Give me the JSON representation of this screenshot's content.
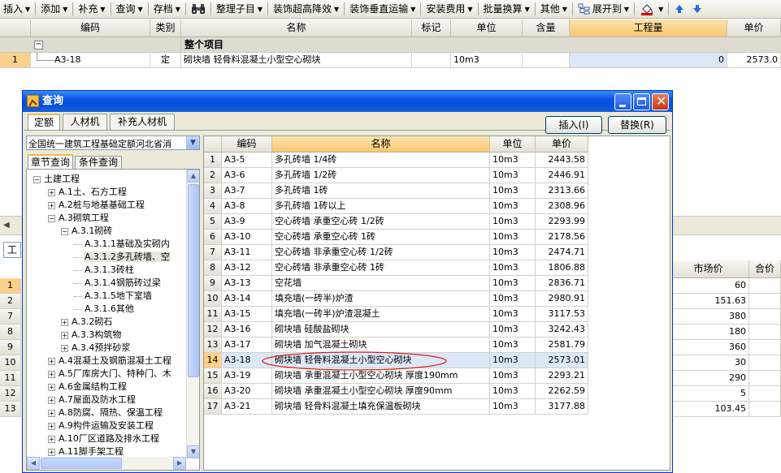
{
  "toolbar": {
    "insert": "插入",
    "add": "添加",
    "supplement": "补充",
    "query": "查询",
    "archive": "存档",
    "tidy": "整理子目",
    "decor_high": "装饰超高降效",
    "decor_vertical": "装饰垂直运输",
    "install_fee": "安装费用",
    "batch_convert": "批量换算",
    "other": "其他",
    "expand": "展开到"
  },
  "main_grid": {
    "headers": [
      "编码",
      "类别",
      "名称",
      "标记",
      "单位",
      "含量",
      "工程量",
      "单价"
    ],
    "section_label": "整个项目",
    "section_toggle": "−",
    "row": {
      "num": "1",
      "code": "A3-18",
      "type": "定",
      "name": "砌块墙 轻骨料混凝土小型空心砌块",
      "unit": "10m3",
      "qty": "0",
      "price": "2573.0"
    }
  },
  "lower_grid": {
    "tab_label": "工",
    "headers": [
      "市场价",
      "合价"
    ],
    "rows": [
      {
        "num": "1",
        "price": "60"
      },
      {
        "num": "2",
        "price": "151.63"
      },
      {
        "num": "7",
        "price": "380"
      },
      {
        "num": "8",
        "price": "180"
      },
      {
        "num": "9",
        "price": "360"
      },
      {
        "num": "10",
        "price": "30"
      },
      {
        "num": "11",
        "price": "290"
      },
      {
        "num": "12",
        "price": "5"
      },
      {
        "num": "13",
        "price": "103.45"
      }
    ]
  },
  "dialog": {
    "title": "查询",
    "tabs": [
      "定额",
      "人材机",
      "补充人材机"
    ],
    "insert_btn": "插入(I)",
    "replace_btn": "替换(R)",
    "dropdown_value": "全国统一建筑工程基础定额河北省消",
    "subtabs": [
      "章节查询",
      "条件查询"
    ],
    "tree": [
      {
        "label": "土建工程",
        "toggle": "−",
        "level": 0
      },
      {
        "label": "A.1土、石方工程",
        "toggle": "+",
        "level": 1
      },
      {
        "label": "A.2桩与地基基础工程",
        "toggle": "+",
        "level": 1
      },
      {
        "label": "A.3砌筑工程",
        "toggle": "−",
        "level": 1
      },
      {
        "label": "A.3.1砌砖",
        "toggle": "−",
        "level": 2
      },
      {
        "label": "A.3.1.1基础及实砌内",
        "toggle": "",
        "level": 3
      },
      {
        "label": "A.3.1.2多孔砖墙、空",
        "toggle": "",
        "level": 3,
        "selected": true
      },
      {
        "label": "A.3.1.3砖柱",
        "toggle": "",
        "level": 3
      },
      {
        "label": "A.3.1.4钢筋砖过梁",
        "toggle": "",
        "level": 3
      },
      {
        "label": "A.3.1.5地下室墙",
        "toggle": "",
        "level": 3
      },
      {
        "label": "A.3.1.6其他",
        "toggle": "",
        "level": 3
      },
      {
        "label": "A.3.2砌石",
        "toggle": "+",
        "level": 2
      },
      {
        "label": "A.3.3构筑物",
        "toggle": "+",
        "level": 2
      },
      {
        "label": "A.3.4预拌砂浆",
        "toggle": "+",
        "level": 2
      },
      {
        "label": "A.4混凝土及钢筋混凝土工程",
        "toggle": "+",
        "level": 1
      },
      {
        "label": "A.5厂库房大门、特种门、木",
        "toggle": "+",
        "level": 1
      },
      {
        "label": "A.6金属结构工程",
        "toggle": "+",
        "level": 1
      },
      {
        "label": "A.7屋面及防水工程",
        "toggle": "+",
        "level": 1
      },
      {
        "label": "A.8防腐、隔热、保温工程",
        "toggle": "+",
        "level": 1
      },
      {
        "label": "A.9构件运输及安装工程",
        "toggle": "+",
        "level": 1
      },
      {
        "label": "A.10厂区道路及排水工程",
        "toggle": "+",
        "level": 1
      },
      {
        "label": "A.11脚手架工程",
        "toggle": "+",
        "level": 1
      }
    ],
    "list_headers": [
      "编码",
      "名称",
      "单位",
      "单价"
    ],
    "list": [
      {
        "n": "1",
        "code": "A3-5",
        "name": "多孔砖墙 1/4砖",
        "unit": "10m3",
        "price": "2443.58"
      },
      {
        "n": "2",
        "code": "A3-6",
        "name": "多孔砖墙 1/2砖",
        "unit": "10m3",
        "price": "2446.91"
      },
      {
        "n": "3",
        "code": "A3-7",
        "name": "多孔砖墙 1砖",
        "unit": "10m3",
        "price": "2313.66"
      },
      {
        "n": "4",
        "code": "A3-8",
        "name": "多孔砖墙 1砖以上",
        "unit": "10m3",
        "price": "2308.96"
      },
      {
        "n": "5",
        "code": "A3-9",
        "name": "空心砖墙 承重空心砖 1/2砖",
        "unit": "10m3",
        "price": "2293.99"
      },
      {
        "n": "6",
        "code": "A3-10",
        "name": "空心砖墙 承重空心砖 1砖",
        "unit": "10m3",
        "price": "2178.56"
      },
      {
        "n": "7",
        "code": "A3-11",
        "name": "空心砖墙 非承重空心砖 1/2砖",
        "unit": "10m3",
        "price": "2474.71"
      },
      {
        "n": "8",
        "code": "A3-12",
        "name": "空心砖墙 非承重空心砖 1砖",
        "unit": "10m3",
        "price": "1806.88"
      },
      {
        "n": "9",
        "code": "A3-13",
        "name": "空花墙",
        "unit": "10m3",
        "price": "2836.71"
      },
      {
        "n": "10",
        "code": "A3-14",
        "name": "填充墙(一砖半)炉渣",
        "unit": "10m3",
        "price": "2980.91"
      },
      {
        "n": "11",
        "code": "A3-15",
        "name": "填充墙(一砖半)炉渣混凝土",
        "unit": "10m3",
        "price": "3117.53"
      },
      {
        "n": "12",
        "code": "A3-16",
        "name": "砌块墙 硅酸盐砌块",
        "unit": "10m3",
        "price": "3242.43"
      },
      {
        "n": "13",
        "code": "A3-17",
        "name": "砌块墙 加气混凝土砌块",
        "unit": "10m3",
        "price": "2581.79"
      },
      {
        "n": "14",
        "code": "A3-18",
        "name": "砌块墙 轻骨料混凝土小型空心砌块",
        "unit": "10m3",
        "price": "2573.01",
        "selected": true
      },
      {
        "n": "15",
        "code": "A3-19",
        "name": "砌块墙 承重混凝土小型空心砌块 厚度190mm",
        "unit": "10m3",
        "price": "2293.21"
      },
      {
        "n": "16",
        "code": "A3-20",
        "name": "砌块墙 承重混凝土小型空心砌块 厚度90mm",
        "unit": "10m3",
        "price": "2262.59"
      },
      {
        "n": "17",
        "code": "A3-21",
        "name": "砌块墙 轻骨料混凝土填充保温板砌块",
        "unit": "10m3",
        "price": "3177.88"
      }
    ]
  },
  "colors": {
    "title_blue": "#0a54e3",
    "highlight_orange": "#fbd08a",
    "selected_row": "#dce7f7",
    "annotation_red": "#d81e1e"
  }
}
